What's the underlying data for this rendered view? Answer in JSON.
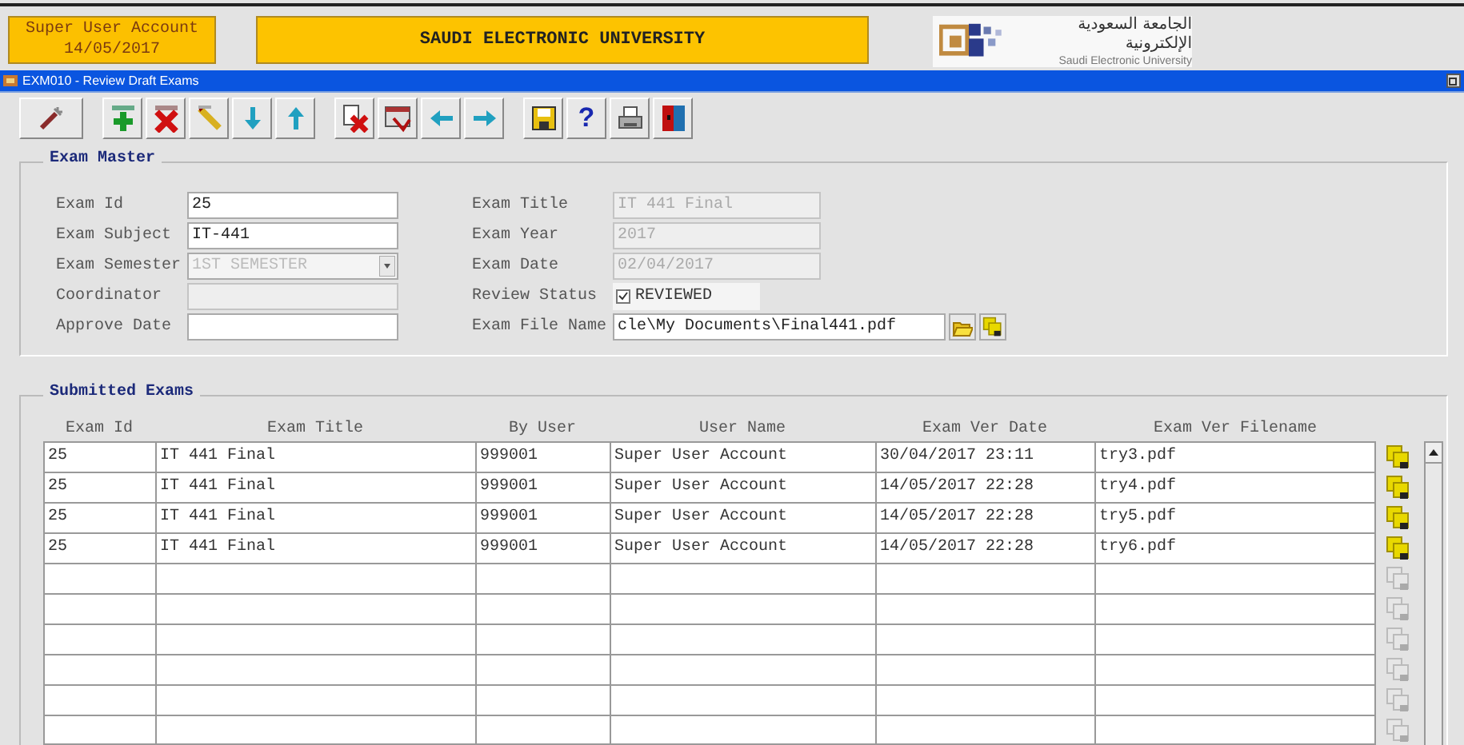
{
  "header": {
    "user": "Super User Account",
    "date": "14/05/2017",
    "institution": "SAUDI ELECTRONIC UNIVERSITY",
    "logo": {
      "arabic": "الجامعة السعودية الإلكترونية",
      "english": "Saudi Electronic University"
    }
  },
  "window": {
    "title": "EXM010 - Review Draft Exams"
  },
  "toolbar": [
    {
      "kind": "tool"
    },
    {
      "kind": "add"
    },
    {
      "kind": "delete"
    },
    {
      "kind": "edit"
    },
    {
      "kind": "down"
    },
    {
      "kind": "up"
    },
    {
      "kind": "remove"
    },
    {
      "kind": "form"
    },
    {
      "kind": "back"
    },
    {
      "kind": "forward"
    },
    {
      "kind": "save"
    },
    {
      "kind": "help",
      "label": "?"
    },
    {
      "kind": "print"
    },
    {
      "kind": "exit"
    }
  ],
  "exam_master": {
    "title": "Exam Master",
    "left": [
      {
        "label": "Exam Id",
        "kind": "text",
        "value": "25",
        "disabled": false
      },
      {
        "label": "Exam Subject",
        "kind": "text",
        "value": "IT-441",
        "disabled": false
      },
      {
        "label": "Exam Semester",
        "kind": "dropdown",
        "value": "1ST SEMESTER",
        "disabled": true
      },
      {
        "label": "Coordinator",
        "kind": "text",
        "disabled": true
      },
      {
        "label": "Approve Date",
        "kind": "text",
        "disabled": false
      }
    ],
    "right": [
      {
        "label": "Exam Title",
        "kind": "text",
        "value": "IT 441 Final",
        "disabled": true
      },
      {
        "label": "Exam Year",
        "kind": "text",
        "value": "2017",
        "disabled": true
      },
      {
        "label": "Exam Date",
        "kind": "text",
        "value": "02/04/2017",
        "disabled": true
      },
      {
        "label": "Review Status",
        "kind": "checkbox",
        "value": "REVIEWED",
        "checked": true
      },
      {
        "label": "Exam File Name",
        "kind": "file",
        "value": "cle\\My Documents\\Final441.pdf",
        "disabled": false
      }
    ]
  },
  "submitted_exams": {
    "title": "Submitted Exams",
    "columns": [
      "Exam Id",
      "Exam Title",
      "By User",
      "User Name",
      "Exam Ver Date",
      "Exam Ver Filename"
    ],
    "rows": [
      {
        "cells": [
          "25",
          "IT 441 Final",
          "999001",
          "Super User Account",
          "30/04/2017 23:11",
          "try3.pdf"
        ]
      },
      {
        "cells": [
          "25",
          "IT 441 Final",
          "999001",
          "Super User Account",
          "14/05/2017 22:28",
          "try4.pdf"
        ]
      },
      {
        "cells": [
          "25",
          "IT 441 Final",
          "999001",
          "Super User Account",
          "14/05/2017 22:28",
          "try5.pdf"
        ]
      },
      {
        "cells": [
          "25",
          "IT 441 Final",
          "999001",
          "Super User Account",
          "14/05/2017 22:28",
          "try6.pdf"
        ]
      }
    ]
  }
}
